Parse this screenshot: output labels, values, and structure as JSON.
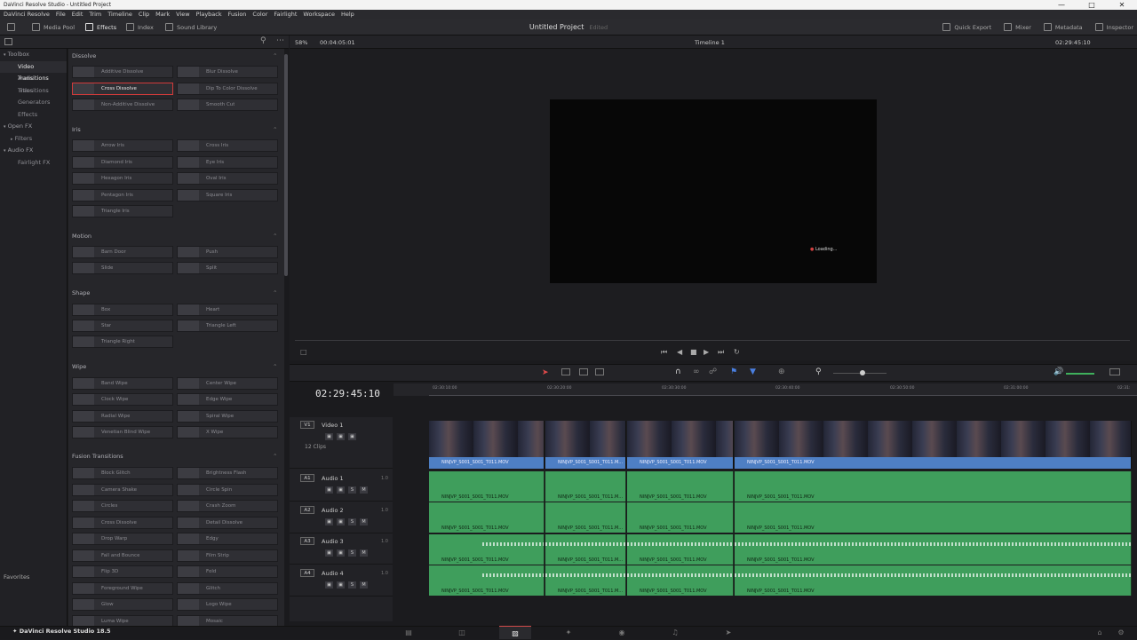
{
  "window_title": "DaVinci Resolve Studio - Untitled Project",
  "menu": [
    "DaVinci Resolve",
    "File",
    "Edit",
    "Trim",
    "Timeline",
    "Clip",
    "Mark",
    "View",
    "Playback",
    "Fusion",
    "Color",
    "Fairlight",
    "Workspace",
    "Help"
  ],
  "toolbar": {
    "media_pool": "Media Pool",
    "effects": "Effects",
    "index": "Index",
    "sound_library": "Sound Library",
    "project_name": "Untitled Project",
    "project_status": "Edited",
    "quick_export": "Quick Export",
    "mixer": "Mixer",
    "metadata": "Metadata",
    "inspector": "Inspector"
  },
  "sidebar": {
    "items": [
      {
        "label": "Toolbox",
        "group": true
      },
      {
        "label": "Video Transitions",
        "selected": true
      },
      {
        "label": "Audio Transitions"
      },
      {
        "label": "Titles"
      },
      {
        "label": "Generators"
      },
      {
        "label": "Effects"
      },
      {
        "label": "Open FX",
        "group": true
      },
      {
        "label": "Filters"
      },
      {
        "label": "Audio FX",
        "group": true
      },
      {
        "label": "Fairlight FX"
      }
    ],
    "favorites": "Favorites"
  },
  "effects": {
    "dissolve": {
      "title": "Dissolve",
      "items": [
        "Additive Dissolve",
        "Blur Dissolve",
        "Cross Dissolve",
        "Dip To Color Dissolve",
        "Non-Additive Dissolve",
        "Smooth Cut"
      ]
    },
    "iris": {
      "title": "Iris",
      "items": [
        "Arrow Iris",
        "Cross Iris",
        "Diamond Iris",
        "Eye Iris",
        "Hexagon Iris",
        "Oval Iris",
        "Pentagon Iris",
        "Square Iris",
        "Triangle Iris"
      ]
    },
    "motion": {
      "title": "Motion",
      "items": [
        "Barn Door",
        "Push",
        "Slide",
        "Split"
      ]
    },
    "shape": {
      "title": "Shape",
      "items": [
        "Box",
        "Heart",
        "Star",
        "Triangle Left",
        "Triangle Right"
      ]
    },
    "wipe": {
      "title": "Wipe",
      "items": [
        "Band Wipe",
        "Center Wipe",
        "Clock Wipe",
        "Edge Wipe",
        "Radial Wipe",
        "Spiral Wipe",
        "Venetian Blind Wipe",
        "X Wipe"
      ]
    },
    "fusion": {
      "title": "Fusion Transitions",
      "items": [
        "Block Glitch",
        "Brightness Flash",
        "Camera Shake",
        "Circle Spin",
        "Circles",
        "Crash Zoom",
        "Cross Dissolve",
        "Detail Dissolve",
        "Drop Warp",
        "Edgy",
        "Fall and Bounce",
        "Film Strip",
        "Flip 3D",
        "Fold",
        "Foreground Wipe",
        "Glitch",
        "Glow",
        "Logo Wipe",
        "Luma Wipe",
        "Mosaic"
      ]
    }
  },
  "viewer": {
    "zoom": "58%",
    "duration": "00:04:05:01",
    "timeline_name": "Timeline 1",
    "timecode": "02:29:45:10",
    "loading": "Loading..."
  },
  "timeline": {
    "timecode": "02:29:45:10",
    "ruler": [
      "02:30:10:00",
      "02:30:20:00",
      "02:30:30:00",
      "02:30:40:00",
      "02:30:50:00",
      "02:31:00:00",
      "02:31:"
    ],
    "tracks": [
      {
        "id": "V1",
        "name": "Video 1",
        "info": "12 Clips"
      },
      {
        "id": "A1",
        "name": "Audio 1",
        "vol": "1.0"
      },
      {
        "id": "A2",
        "name": "Audio 2",
        "vol": "1.0"
      },
      {
        "id": "A3",
        "name": "Audio 3",
        "vol": "1.0"
      },
      {
        "id": "A4",
        "name": "Audio 4",
        "vol": "1.0"
      }
    ],
    "clip_names": [
      "NINJVP_S001_S001_T011.MOV",
      "NINJVP_S001_S001_T011.M...",
      "NINJVP_S001_S001_T011.MOV",
      "NINJVP_S001_S001_T011.MOV"
    ]
  },
  "footer": {
    "brand": "DaVinci Resolve Studio 18.5"
  }
}
